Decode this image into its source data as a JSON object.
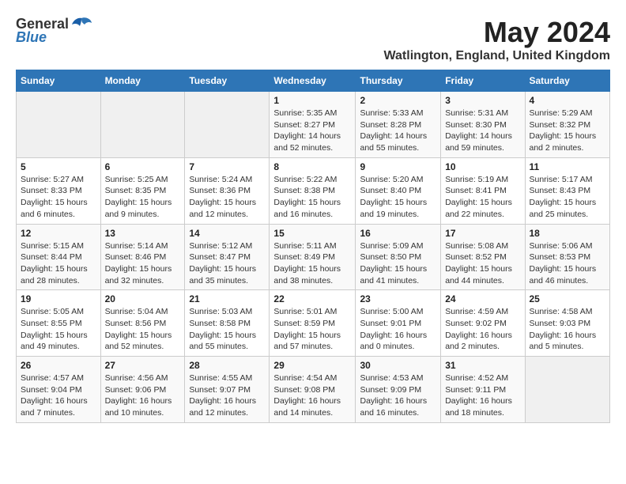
{
  "header": {
    "logo_general": "General",
    "logo_blue": "Blue",
    "month_title": "May 2024",
    "location": "Watlington, England, United Kingdom"
  },
  "weekdays": [
    "Sunday",
    "Monday",
    "Tuesday",
    "Wednesday",
    "Thursday",
    "Friday",
    "Saturday"
  ],
  "weeks": [
    [
      {
        "day": "",
        "info": ""
      },
      {
        "day": "",
        "info": ""
      },
      {
        "day": "",
        "info": ""
      },
      {
        "day": "1",
        "info": "Sunrise: 5:35 AM\nSunset: 8:27 PM\nDaylight: 14 hours\nand 52 minutes."
      },
      {
        "day": "2",
        "info": "Sunrise: 5:33 AM\nSunset: 8:28 PM\nDaylight: 14 hours\nand 55 minutes."
      },
      {
        "day": "3",
        "info": "Sunrise: 5:31 AM\nSunset: 8:30 PM\nDaylight: 14 hours\nand 59 minutes."
      },
      {
        "day": "4",
        "info": "Sunrise: 5:29 AM\nSunset: 8:32 PM\nDaylight: 15 hours\nand 2 minutes."
      }
    ],
    [
      {
        "day": "5",
        "info": "Sunrise: 5:27 AM\nSunset: 8:33 PM\nDaylight: 15 hours\nand 6 minutes."
      },
      {
        "day": "6",
        "info": "Sunrise: 5:25 AM\nSunset: 8:35 PM\nDaylight: 15 hours\nand 9 minutes."
      },
      {
        "day": "7",
        "info": "Sunrise: 5:24 AM\nSunset: 8:36 PM\nDaylight: 15 hours\nand 12 minutes."
      },
      {
        "day": "8",
        "info": "Sunrise: 5:22 AM\nSunset: 8:38 PM\nDaylight: 15 hours\nand 16 minutes."
      },
      {
        "day": "9",
        "info": "Sunrise: 5:20 AM\nSunset: 8:40 PM\nDaylight: 15 hours\nand 19 minutes."
      },
      {
        "day": "10",
        "info": "Sunrise: 5:19 AM\nSunset: 8:41 PM\nDaylight: 15 hours\nand 22 minutes."
      },
      {
        "day": "11",
        "info": "Sunrise: 5:17 AM\nSunset: 8:43 PM\nDaylight: 15 hours\nand 25 minutes."
      }
    ],
    [
      {
        "day": "12",
        "info": "Sunrise: 5:15 AM\nSunset: 8:44 PM\nDaylight: 15 hours\nand 28 minutes."
      },
      {
        "day": "13",
        "info": "Sunrise: 5:14 AM\nSunset: 8:46 PM\nDaylight: 15 hours\nand 32 minutes."
      },
      {
        "day": "14",
        "info": "Sunrise: 5:12 AM\nSunset: 8:47 PM\nDaylight: 15 hours\nand 35 minutes."
      },
      {
        "day": "15",
        "info": "Sunrise: 5:11 AM\nSunset: 8:49 PM\nDaylight: 15 hours\nand 38 minutes."
      },
      {
        "day": "16",
        "info": "Sunrise: 5:09 AM\nSunset: 8:50 PM\nDaylight: 15 hours\nand 41 minutes."
      },
      {
        "day": "17",
        "info": "Sunrise: 5:08 AM\nSunset: 8:52 PM\nDaylight: 15 hours\nand 44 minutes."
      },
      {
        "day": "18",
        "info": "Sunrise: 5:06 AM\nSunset: 8:53 PM\nDaylight: 15 hours\nand 46 minutes."
      }
    ],
    [
      {
        "day": "19",
        "info": "Sunrise: 5:05 AM\nSunset: 8:55 PM\nDaylight: 15 hours\nand 49 minutes."
      },
      {
        "day": "20",
        "info": "Sunrise: 5:04 AM\nSunset: 8:56 PM\nDaylight: 15 hours\nand 52 minutes."
      },
      {
        "day": "21",
        "info": "Sunrise: 5:03 AM\nSunset: 8:58 PM\nDaylight: 15 hours\nand 55 minutes."
      },
      {
        "day": "22",
        "info": "Sunrise: 5:01 AM\nSunset: 8:59 PM\nDaylight: 15 hours\nand 57 minutes."
      },
      {
        "day": "23",
        "info": "Sunrise: 5:00 AM\nSunset: 9:01 PM\nDaylight: 16 hours\nand 0 minutes."
      },
      {
        "day": "24",
        "info": "Sunrise: 4:59 AM\nSunset: 9:02 PM\nDaylight: 16 hours\nand 2 minutes."
      },
      {
        "day": "25",
        "info": "Sunrise: 4:58 AM\nSunset: 9:03 PM\nDaylight: 16 hours\nand 5 minutes."
      }
    ],
    [
      {
        "day": "26",
        "info": "Sunrise: 4:57 AM\nSunset: 9:04 PM\nDaylight: 16 hours\nand 7 minutes."
      },
      {
        "day": "27",
        "info": "Sunrise: 4:56 AM\nSunset: 9:06 PM\nDaylight: 16 hours\nand 10 minutes."
      },
      {
        "day": "28",
        "info": "Sunrise: 4:55 AM\nSunset: 9:07 PM\nDaylight: 16 hours\nand 12 minutes."
      },
      {
        "day": "29",
        "info": "Sunrise: 4:54 AM\nSunset: 9:08 PM\nDaylight: 16 hours\nand 14 minutes."
      },
      {
        "day": "30",
        "info": "Sunrise: 4:53 AM\nSunset: 9:09 PM\nDaylight: 16 hours\nand 16 minutes."
      },
      {
        "day": "31",
        "info": "Sunrise: 4:52 AM\nSunset: 9:11 PM\nDaylight: 16 hours\nand 18 minutes."
      },
      {
        "day": "",
        "info": ""
      }
    ]
  ]
}
